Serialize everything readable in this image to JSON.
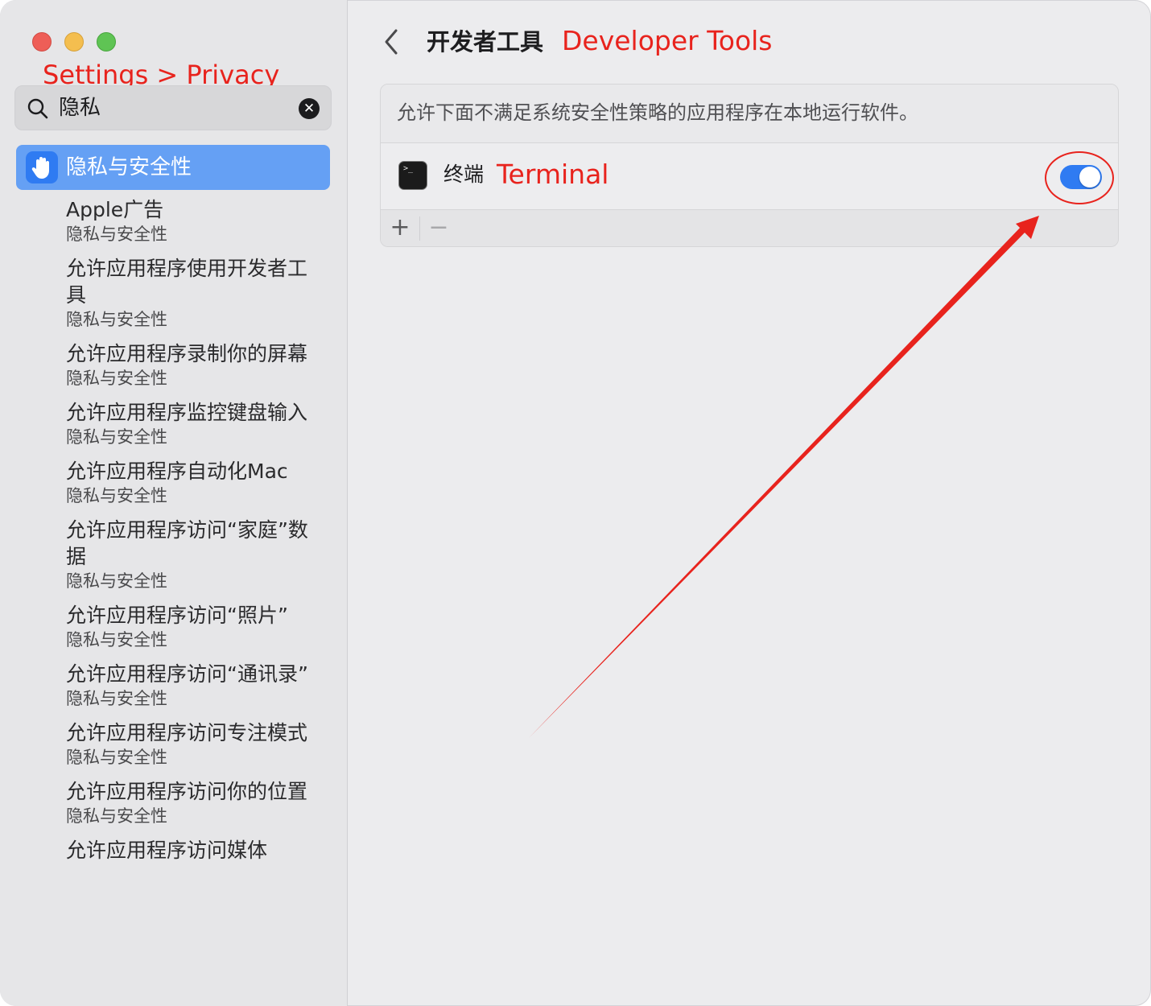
{
  "window": {
    "traffic_lights": [
      "close",
      "minimize",
      "maximize"
    ]
  },
  "annotations": {
    "settings_path": "Settings > Privacy",
    "page": "Developer Tools",
    "app": "Terminal",
    "color": "#e8231d"
  },
  "sidebar": {
    "search": {
      "value": "隐私",
      "icon": "search-icon",
      "clear_icon": "✕"
    },
    "selected": {
      "label": "隐私与安全性",
      "icon": "hand-raised-icon"
    },
    "results": [
      {
        "title": "Apple广告",
        "subtitle": "隐私与安全性"
      },
      {
        "title": "允许应用程序使用开发者工具",
        "subtitle": "隐私与安全性"
      },
      {
        "title": "允许应用程序录制你的屏幕",
        "subtitle": "隐私与安全性"
      },
      {
        "title": "允许应用程序监控键盘输入",
        "subtitle": "隐私与安全性"
      },
      {
        "title": "允许应用程序自动化Mac",
        "subtitle": "隐私与安全性"
      },
      {
        "title": "允许应用程序访问“家庭”数据",
        "subtitle": "隐私与安全性"
      },
      {
        "title": "允许应用程序访问“照片”",
        "subtitle": "隐私与安全性"
      },
      {
        "title": "允许应用程序访问“通讯录”",
        "subtitle": "隐私与安全性"
      },
      {
        "title": "允许应用程序访问专注模式",
        "subtitle": "隐私与安全性"
      },
      {
        "title": "允许应用程序访问你的位置",
        "subtitle": "隐私与安全性"
      },
      {
        "title": "允许应用程序访问媒体",
        "subtitle": ""
      }
    ]
  },
  "main": {
    "title": "开发者工具",
    "description": "允许下面不满足系统安全性策略的应用程序在本地运行软件。",
    "apps": [
      {
        "name": "终端",
        "icon": "terminal-icon",
        "enabled": true
      }
    ],
    "footer": {
      "add": "+",
      "remove": "−"
    }
  },
  "colors": {
    "accent": "#2f7bf2",
    "selection": "#65a0f4"
  }
}
